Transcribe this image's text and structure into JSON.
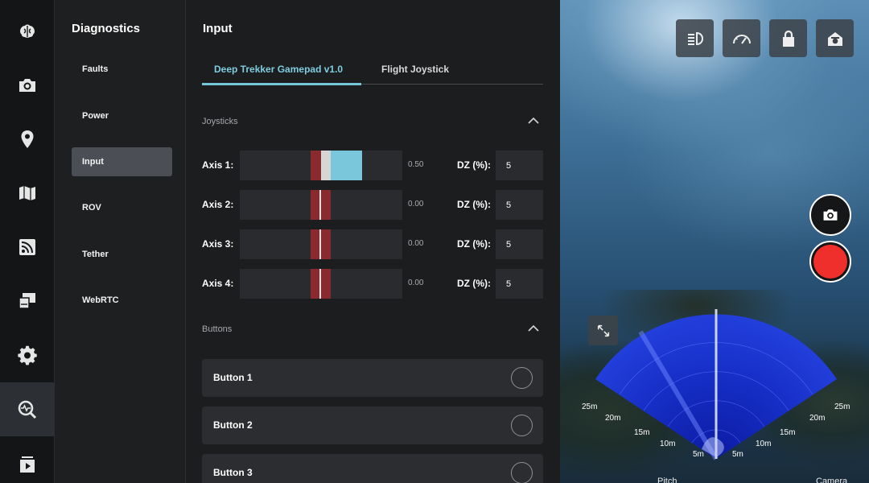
{
  "rail": {
    "items": [
      {
        "icon": "brain-icon"
      },
      {
        "icon": "camera-icon"
      },
      {
        "icon": "location-pin-icon"
      },
      {
        "icon": "map-icon"
      },
      {
        "icon": "signal-feed-icon"
      },
      {
        "icon": "display-settings-icon"
      },
      {
        "icon": "gear-icon"
      },
      {
        "icon": "diagnostics-icon",
        "active": true
      },
      {
        "icon": "media-gallery-icon"
      }
    ]
  },
  "diagnostics": {
    "title": "Diagnostics",
    "items": [
      {
        "label": "Faults"
      },
      {
        "label": "Power"
      },
      {
        "label": "Input",
        "active": true
      },
      {
        "label": "ROV"
      },
      {
        "label": "Tether"
      },
      {
        "label": "WebRTC"
      }
    ]
  },
  "input": {
    "title": "Input",
    "tabs": [
      {
        "label": "Deep Trekker Gamepad v1.0",
        "active": true
      },
      {
        "label": "Flight Joystick"
      }
    ],
    "joysticks": {
      "title": "Joysticks",
      "dz_label": "DZ (%):",
      "axes": [
        {
          "label": "Axis 1:",
          "value": "0.50",
          "level": 0.5,
          "dz": "5"
        },
        {
          "label": "Axis 2:",
          "value": "0.00",
          "level": 0.0,
          "dz": "5"
        },
        {
          "label": "Axis 3:",
          "value": "0.00",
          "level": 0.0,
          "dz": "5"
        },
        {
          "label": "Axis 4:",
          "value": "0.00",
          "level": 0.0,
          "dz": "5"
        }
      ]
    },
    "buttons": {
      "title": "Buttons",
      "items": [
        {
          "label": "Button 1"
        },
        {
          "label": "Button 2"
        },
        {
          "label": "Button 3"
        }
      ]
    }
  },
  "camera": {
    "top_buttons": [
      {
        "icon": "headlight-icon"
      },
      {
        "icon": "speedometer-icon"
      },
      {
        "icon": "lock-icon"
      },
      {
        "icon": "home-camera-icon"
      }
    ],
    "sonar_ranges": [
      "5m",
      "10m",
      "15m",
      "20m",
      "25m"
    ],
    "bottom_labels": [
      "Pitch",
      "Camera"
    ],
    "colors": {
      "record": "#ee2f2b",
      "accent": "#74c6db",
      "deadzone": "#8a2a2e"
    }
  }
}
